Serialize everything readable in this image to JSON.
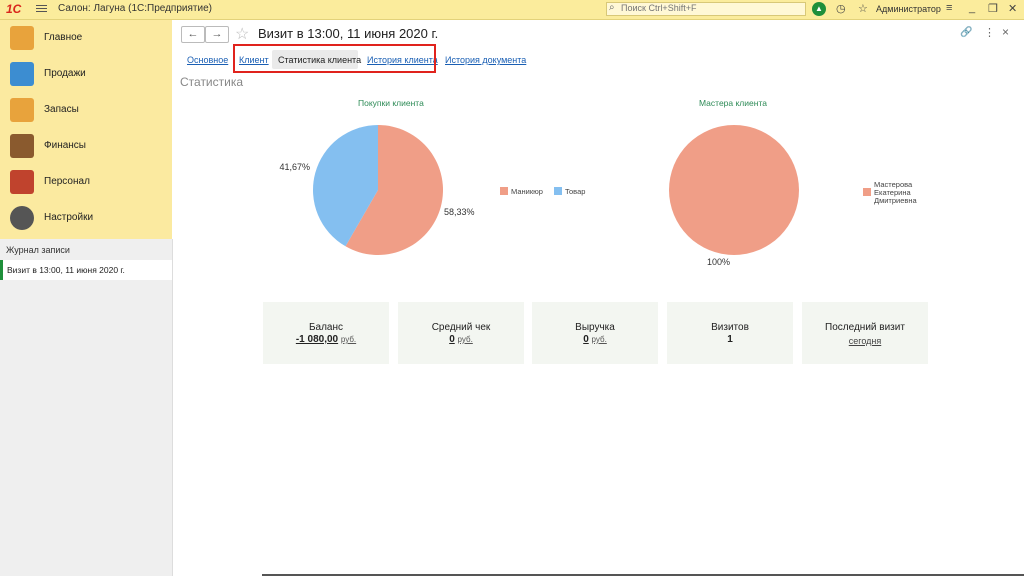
{
  "titlebar": {
    "logo": "1С",
    "title": "Салон: Лагуна  (1С:Предприятие)",
    "search_placeholder": "Поиск Ctrl+Shift+F",
    "user": "Администратор",
    "window_buttons": [
      "_",
      "❐",
      "✕"
    ]
  },
  "sidebar": {
    "items": [
      {
        "label": "Главное",
        "icon": "clipboard-icon",
        "color": "#e8a33c"
      },
      {
        "label": "Продажи",
        "icon": "chart-icon",
        "color": "#3c8dd1"
      },
      {
        "label": "Запасы",
        "icon": "box-icon",
        "color": "#e8a33c"
      },
      {
        "label": "Финансы",
        "icon": "wallet-icon",
        "color": "#8a5a2e"
      },
      {
        "label": "Персонал",
        "icon": "people-icon",
        "color": "#c0432d"
      },
      {
        "label": "Настройки",
        "icon": "gear-icon",
        "color": "#555555"
      }
    ]
  },
  "journal": {
    "title": "Журнал записи",
    "item": "Визит в 13:00, 11 июня 2020 г."
  },
  "document": {
    "title": "Визит в 13:00, 11 июня 2020 г.",
    "back": "←",
    "forward": "→"
  },
  "tabs": [
    {
      "label": "Основное"
    },
    {
      "label": "Клиент"
    },
    {
      "label": "Статистика клиента"
    },
    {
      "label": "История клиента"
    },
    {
      "label": "История документа"
    }
  ],
  "section_title": "Статистика",
  "chart_data": [
    {
      "type": "pie",
      "title": "Покупки клиента",
      "labels": [
        "Маникюр",
        "Товар"
      ],
      "values": [
        58.33,
        41.67
      ],
      "data_labels": [
        "58,33%",
        "41,67%"
      ],
      "colors": [
        "#f09e87",
        "#84bff0"
      ],
      "legend": "right"
    },
    {
      "type": "pie",
      "title": "Мастера клиента",
      "labels": [
        "Мастерова Екатерина Дмитриевна"
      ],
      "legend_lines": [
        "Мастерова",
        "Екатерина",
        "Дмитриевна"
      ],
      "values": [
        100
      ],
      "data_labels": [
        "100%"
      ],
      "colors": [
        "#f09e87"
      ],
      "legend": "right"
    }
  ],
  "cards": [
    {
      "title": "Баланс",
      "value": "-1 080,00",
      "unit": "руб."
    },
    {
      "title": "Средний чек",
      "value": "0",
      "unit": "руб."
    },
    {
      "title": "Выручка",
      "value": "0",
      "unit": "руб."
    },
    {
      "title": "Визитов",
      "value": "1"
    },
    {
      "title": "Последний визит",
      "link": "сегодня"
    }
  ],
  "colors": {
    "accent": "#fbec9c",
    "highlight": "#e0231d",
    "chart_title": "#2e8b57"
  }
}
